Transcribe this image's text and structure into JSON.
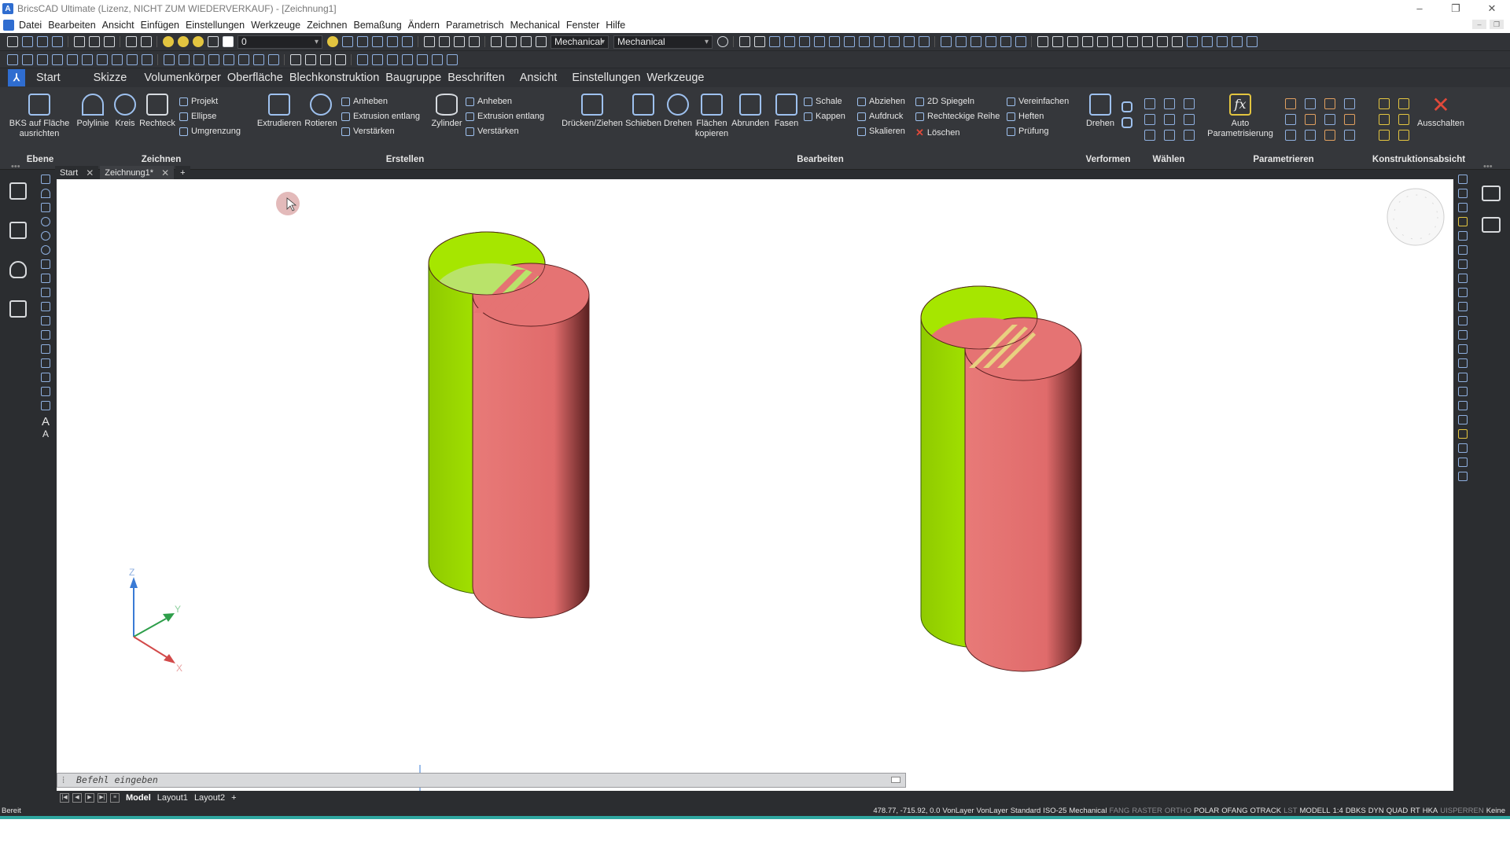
{
  "title_bar": {
    "text": "BricsCAD Ultimate (Lizenz, NICHT ZUM WIEDERVERKAUF) - [Zeichnung1]",
    "app_icon": "A"
  },
  "menu": [
    "Datei",
    "Bearbeiten",
    "Ansicht",
    "Einfügen",
    "Einstellungen",
    "Werkzeuge",
    "Zeichnen",
    "Bemaßung",
    "Ändern",
    "Parametrisch",
    "Mechanical",
    "Fenster",
    "Hilfe"
  ],
  "toolbar": {
    "layer_value": "0",
    "workspace_1": "Mechanical",
    "workspace_2": "Mechanical"
  },
  "ribbon_tabs": [
    "Start",
    "Skizze",
    "Volumenkörper",
    "Oberfläche",
    "Blechkonstruktion",
    "Baugruppe",
    "Beschriften",
    "Ansicht",
    "Einstellungen",
    "Werkzeuge"
  ],
  "ribbon": {
    "bks": "BKS auf Fläche ausrichten",
    "polylinie": "Polylinie",
    "kreis": "Kreis",
    "rechteck": "Rechteck",
    "projekt": "Projekt",
    "ellipse": "Ellipse",
    "umgrenzung": "Umgrenzung",
    "extrudieren": "Extrudieren",
    "rotieren": "Rotieren",
    "anheben1": "Anheben",
    "extrusion1": "Extrusion entlang",
    "verstaerken1": "Verstärken",
    "zylinder": "Zylinder",
    "anheben2": "Anheben",
    "extrusion2": "Extrusion entlang",
    "verstaerken2": "Verstärken",
    "druecken": "Drücken/Ziehen",
    "schieben": "Schieben",
    "drehen1": "Drehen",
    "flaechen": "Flächen kopieren",
    "abrunden": "Abrunden",
    "fasen": "Fasen",
    "schale": "Schale",
    "kappen": "Kappen",
    "abziehen": "Abziehen",
    "aufdruck": "Aufdruck",
    "skalieren": "Skalieren",
    "spiegeln": "2D Spiegeln",
    "rechteckige": "Rechteckige Reihe",
    "loeschen": "Löschen",
    "vereinfachen": "Vereinfachen",
    "heften": "Heften",
    "pruefung": "Prüfung",
    "drehen2": "Drehen",
    "auto_param": "Auto Parametrisierung",
    "ausschalten": "Ausschalten"
  },
  "ribbon_groups": [
    "Ebene",
    "Zeichnen",
    "Erstellen",
    "Bearbeiten",
    "Verformen",
    "Wählen",
    "Parametrieren",
    "Konstruktionsabsicht"
  ],
  "doc_tabs": [
    "Start",
    "Zeichnung1*"
  ],
  "left_text_tools": [
    "A",
    "A"
  ],
  "command_line": {
    "placeholder": "Befehl eingeben"
  },
  "layout_tabs": [
    "Model",
    "Layout1",
    "Layout2",
    "+"
  ],
  "status": {
    "left": "Bereit",
    "coords": "478.77, -715.92, 0.0",
    "layer": "VonLayer",
    "linetype": "VonLayer",
    "textstyle": "Standard",
    "dimstyle": "ISO-25",
    "workspace": "Mechanical",
    "toggles_off": [
      "FANG",
      "RASTER",
      "ORTHO"
    ],
    "toggles_on": [
      "POLAR",
      "OFANG",
      "OTRACK"
    ],
    "lst": "LST",
    "modell": "MODELL",
    "scale": "1:4",
    "toggles_right": [
      "DBKS",
      "DYN",
      "QUAD",
      "RT",
      "HKA"
    ],
    "uisperren": "UISPERREN",
    "keine": "Keine"
  },
  "ucs_axes": {
    "z": "Z",
    "y": "Y",
    "x": "X"
  },
  "colors": {
    "yellow_green": "#a6e600",
    "salmon": "#e57373",
    "viewport_bg": "#ffffff",
    "ui_dark": "#2b2d30"
  }
}
